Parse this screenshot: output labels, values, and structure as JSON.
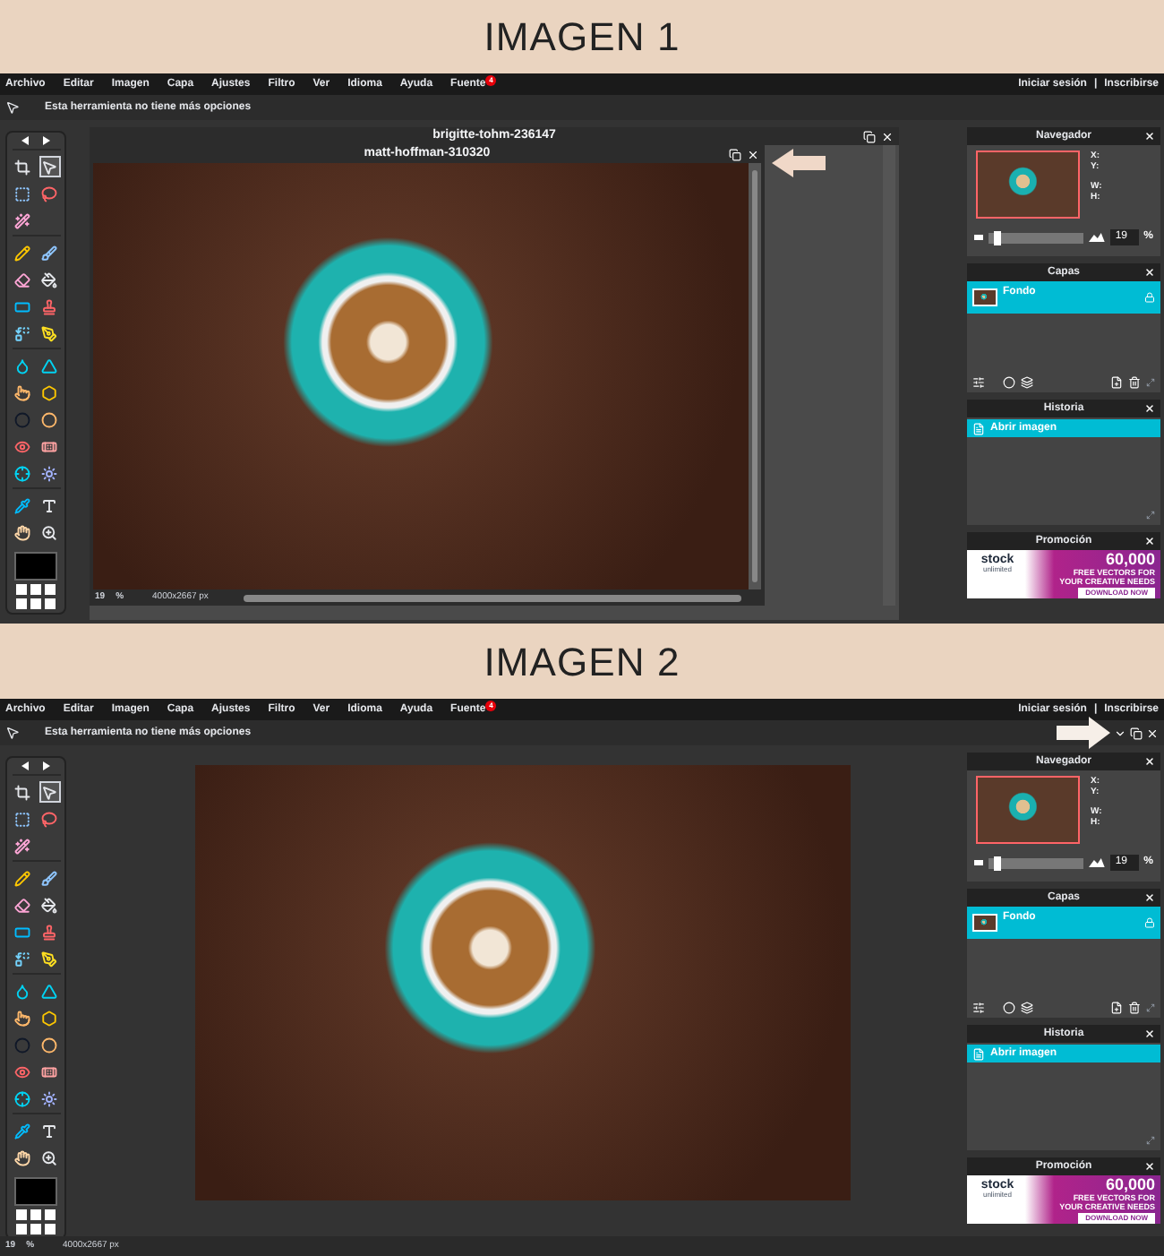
{
  "sections": [
    {
      "heading": "IMAGEN 1",
      "screen": {
        "kind": "windowed",
        "menu": [
          {
            "label": "Archivo"
          },
          {
            "label": "Editar"
          },
          {
            "label": "Imagen"
          },
          {
            "label": "Capa"
          },
          {
            "label": "Ajustes"
          },
          {
            "label": "Filtro"
          },
          {
            "label": "Ver"
          },
          {
            "label": "Idioma"
          },
          {
            "label": "Ayuda"
          },
          {
            "label": "Fuente",
            "badge": "4"
          }
        ],
        "account": [
          "Iniciar sesión",
          "|",
          "Inscribirse"
        ],
        "options_text": "Esta herramienta no tiene más opciones",
        "tool_groups": [
          [
            {
              "selected": false
            },
            {
              "selected": true
            },
            {
              "selected": false
            },
            {
              "selected": false
            },
            {
              "selected": false
            }
          ],
          [
            {
              "selected": false
            },
            {
              "selected": false
            },
            {
              "selected": false
            },
            {
              "selected": false
            },
            {
              "selected": false
            },
            {
              "selected": false
            },
            {
              "selected": false
            },
            {
              "selected": false
            }
          ],
          [
            {
              "selected": false
            },
            {
              "selected": false
            },
            {
              "selected": false
            },
            {
              "selected": false
            },
            {
              "selected": false
            },
            {
              "selected": false
            },
            {
              "selected": false
            },
            {
              "selected": false
            },
            {
              "selected": false
            },
            {
              "selected": false
            }
          ],
          [
            {
              "selected": false
            },
            {
              "selected": false
            },
            {
              "selected": false
            },
            {
              "selected": false
            }
          ]
        ],
        "windows": [
          {
            "title": "brigitte-tohm-236147"
          },
          {
            "title": "matt-hoffman-310320"
          }
        ],
        "status": {
          "zoom": "19",
          "unit": "%",
          "size": "4000x2667 px"
        },
        "navigator": {
          "title": "Navegador",
          "coords": [
            "X:",
            "Y:",
            "W:",
            "H:"
          ],
          "level": 0.05,
          "zoom": "19",
          "unit": "%"
        },
        "layers": {
          "title": "Capas",
          "items": [
            {
              "label": "Fondo",
              "selected": true
            }
          ]
        },
        "history": {
          "title": "Historia",
          "items": [
            {
              "label": "Abrir imagen",
              "selected": true
            }
          ]
        },
        "promo": {
          "title": "Promoción",
          "brand": "stock",
          "brand_sub": "unlimited",
          "big": "60,000",
          "line1": "FREE VECTORS FOR",
          "line2": "YOUR CREATIVE NEEDS",
          "cta": "DOWNLOAD NOW"
        }
      }
    },
    {
      "heading": "IMAGEN 2",
      "screen": {
        "kind": "fullscreen",
        "menu": [
          {
            "label": "Archivo"
          },
          {
            "label": "Editar"
          },
          {
            "label": "Imagen"
          },
          {
            "label": "Capa"
          },
          {
            "label": "Ajustes"
          },
          {
            "label": "Filtro"
          },
          {
            "label": "Ver"
          },
          {
            "label": "Idioma"
          },
          {
            "label": "Ayuda"
          },
          {
            "label": "Fuente",
            "badge": "4"
          }
        ],
        "account": [
          "Iniciar sesión",
          "|",
          "Inscribirse"
        ],
        "options_text": "Esta herramienta no tiene más opciones",
        "tool_groups": [
          [
            {
              "selected": false
            },
            {
              "selected": true
            },
            {
              "selected": false
            },
            {
              "selected": false
            },
            {
              "selected": false
            }
          ],
          [
            {
              "selected": false
            },
            {
              "selected": false
            },
            {
              "selected": false
            },
            {
              "selected": false
            },
            {
              "selected": false
            },
            {
              "selected": false
            },
            {
              "selected": false
            },
            {
              "selected": false
            }
          ],
          [
            {
              "selected": false
            },
            {
              "selected": false
            },
            {
              "selected": false
            },
            {
              "selected": false
            },
            {
              "selected": false
            },
            {
              "selected": false
            },
            {
              "selected": false
            },
            {
              "selected": false
            },
            {
              "selected": false
            },
            {
              "selected": false
            }
          ],
          [
            {
              "selected": false
            },
            {
              "selected": false
            },
            {
              "selected": false
            },
            {
              "selected": false
            }
          ]
        ],
        "status": {
          "zoom": "19",
          "unit": "%",
          "size": "4000x2667 px"
        },
        "navigator": {
          "title": "Navegador",
          "coords": [
            "X:",
            "Y:",
            "W:",
            "H:"
          ],
          "level": 0.05,
          "zoom": "19",
          "unit": "%"
        },
        "layers": {
          "title": "Capas",
          "items": [
            {
              "label": "Fondo",
              "selected": true
            }
          ]
        },
        "history": {
          "title": "Historia",
          "items": [
            {
              "label": "Abrir imagen",
              "selected": true
            }
          ]
        },
        "promo": {
          "title": "Promoción",
          "brand": "stock",
          "brand_sub": "unlimited",
          "big": "60,000",
          "line1": "FREE VECTORS FOR",
          "line2": "YOUR CREATIVE NEEDS",
          "cta": "DOWNLOAD NOW"
        }
      }
    }
  ]
}
